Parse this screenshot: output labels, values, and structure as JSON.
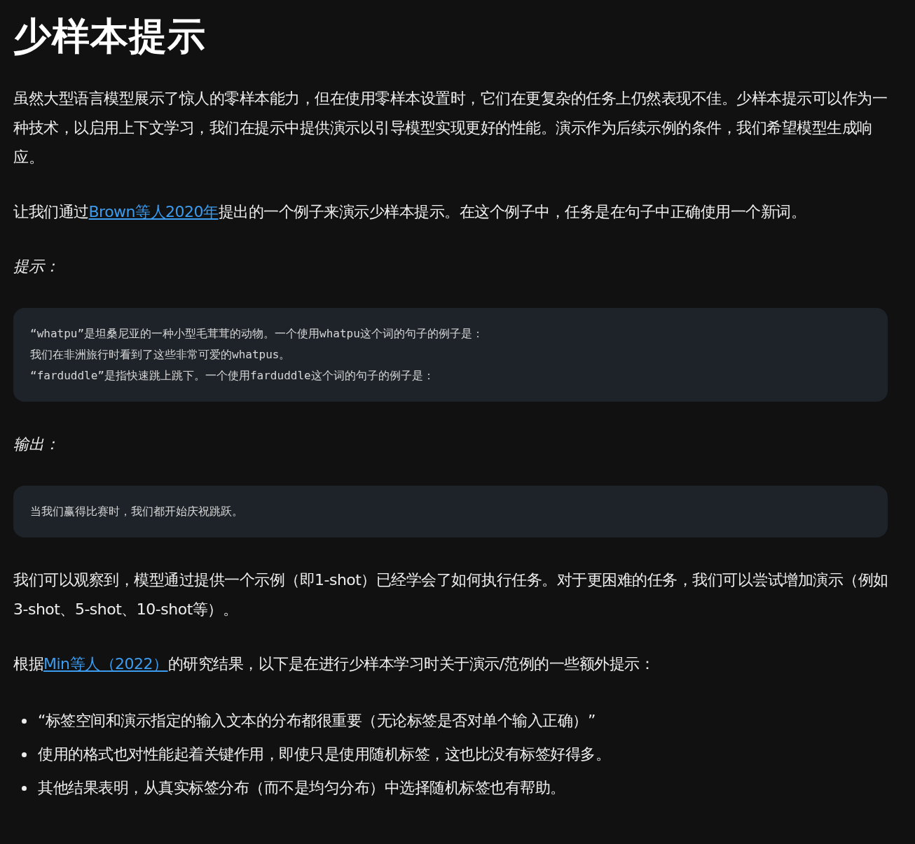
{
  "title": "少样本提示",
  "blocks": [
    {
      "kind": "paragraph",
      "parts": [
        {
          "kind": "text",
          "text": "虽然大型语言模型展示了惊人的零样本能力，但在使用零样本设置时，它们在更复杂的任务上仍然表现不佳。少样本提示可以作为一种技术，以启用上下文学习，我们在提示中提供演示以引导模型实现更好的性能。演示作为后续示例的条件，我们希望模型生成响应。"
        }
      ]
    },
    {
      "kind": "paragraph",
      "parts": [
        {
          "kind": "text",
          "text": "让我们通过"
        },
        {
          "kind": "link",
          "text": "Brown等人2020年"
        },
        {
          "kind": "text",
          "text": "提出的一个例子来演示少样本提示。在这个例子中，任务是在句子中正确使用一个新词。"
        }
      ]
    },
    {
      "kind": "label",
      "text": "提示："
    },
    {
      "kind": "code",
      "lines": [
        "“whatpu”是坦桑尼亚的一种小型毛茸茸的动物。一个使用whatpu这个词的句子的例子是：",
        "我们在非洲旅行时看到了这些非常可爱的whatpus。",
        "“farduddle”是指快速跳上跳下。一个使用farduddle这个词的句子的例子是："
      ]
    },
    {
      "kind": "label",
      "text": "输出："
    },
    {
      "kind": "code",
      "lines": [
        "当我们赢得比赛时，我们都开始庆祝跳跃。"
      ]
    },
    {
      "kind": "paragraph",
      "parts": [
        {
          "kind": "text",
          "text": "我们可以观察到，模型通过提供一个示例（即1-shot）已经学会了如何执行任务。对于更困难的任务，我们可以尝试增加演示（例如3-shot、5-shot、10-shot等）。"
        }
      ]
    },
    {
      "kind": "paragraph",
      "parts": [
        {
          "kind": "text",
          "text": "根据"
        },
        {
          "kind": "link",
          "text": "Min等人（2022）"
        },
        {
          "kind": "text",
          "text": "的研究结果，以下是在进行少样本学习时关于演示/范例的一些额外提示："
        }
      ]
    },
    {
      "kind": "list",
      "items": [
        "“标签空间和演示指定的输入文本的分布都很重要（无论标签是否对单个输入正确）”",
        "使用的格式也对性能起着关键作用，即使只是使用随机标签，这也比没有标签好得多。",
        "其他结果表明，从真实标签分布（而不是均匀分布）中选择随机标签也有帮助。"
      ]
    }
  ]
}
